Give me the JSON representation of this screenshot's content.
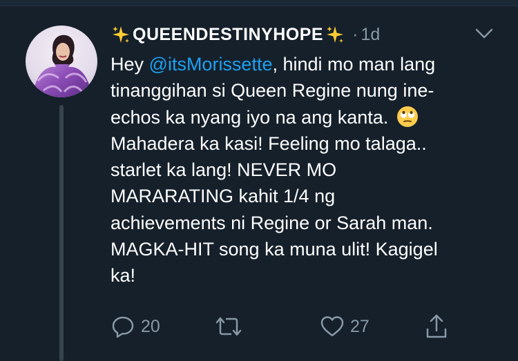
{
  "tweet": {
    "display_name": "QUEENDESTINYHOPE",
    "time_separator": "·",
    "timestamp": "1d",
    "text": {
      "line1_pre": "Hey ",
      "mention": "@itsMorissette",
      "line1_post": ", hindi mo man lang",
      "line2": "tinanggihan si Queen Regine nung ine-",
      "line3": "echos ka nyang iyo na ang kanta.",
      "line4": "Mahadera ka kasi! Feeling mo talaga..",
      "line5": "starlet ka lang! NEVER MO",
      "line6": "MARARATING kahit 1/4 ng",
      "line7": "achievements ni Regine or Sarah man.",
      "line8": "MAGKA-HIT song ka muna ulit! Kagigel",
      "line9": "ka!"
    },
    "emoji": "face-with-rolling-eyes",
    "reply_count": "20",
    "like_count": "27"
  },
  "icons": {
    "name_decoration": "sparkles-icon",
    "menu": "chevron-down-icon",
    "reply": "reply-icon",
    "retweet": "retweet-icon",
    "like": "heart-icon",
    "share": "share-icon"
  },
  "colors": {
    "background": "#15202b",
    "text": "#ffffff",
    "muted": "#8899a6",
    "link": "#1da1f2",
    "thread_line": "#38444d"
  }
}
